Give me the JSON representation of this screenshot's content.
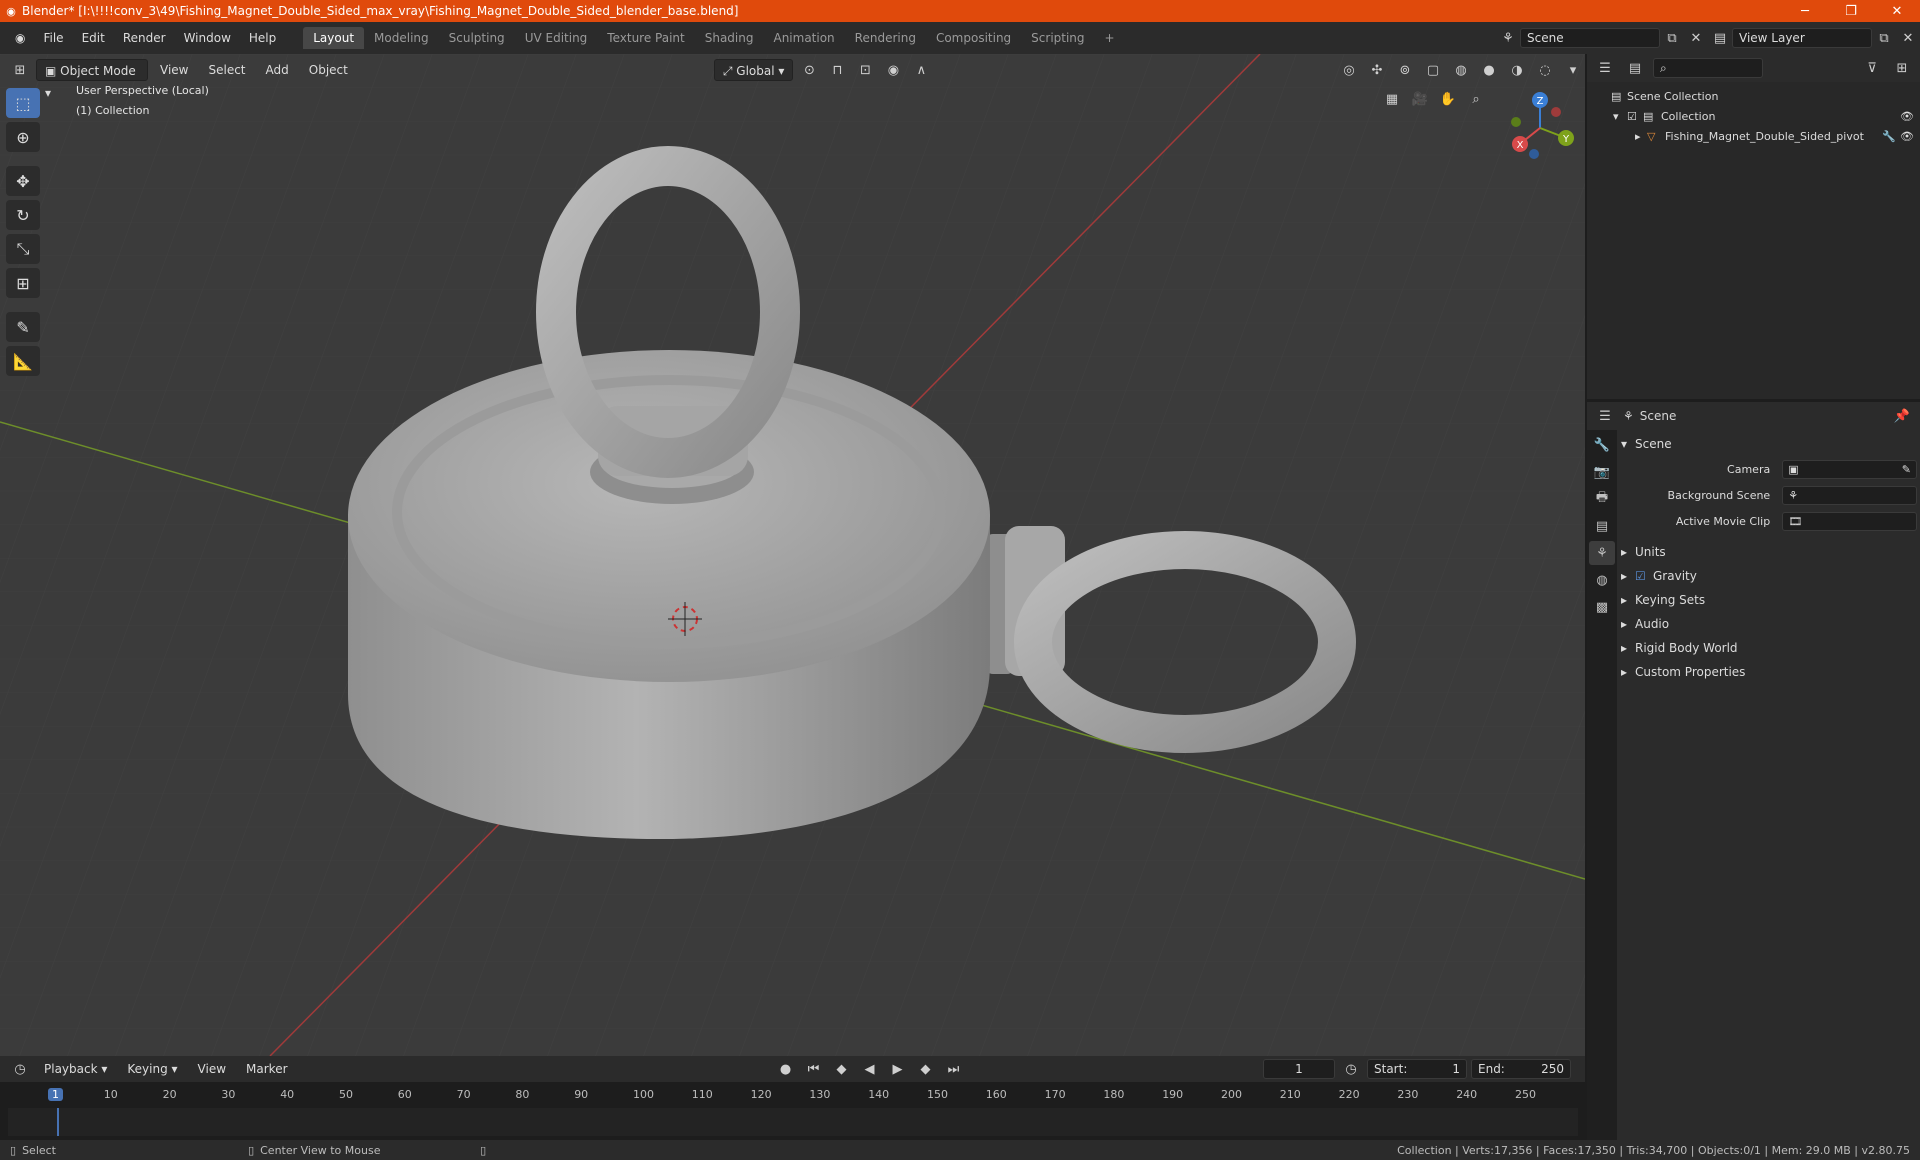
{
  "window": {
    "title": "Blender* [I:\\!!!!conv_3\\49\\Fishing_Magnet_Double_Sided_max_vray\\Fishing_Magnet_Double_Sided_blender_base.blend]"
  },
  "menu": [
    "File",
    "Edit",
    "Render",
    "Window",
    "Help"
  ],
  "workspaces": [
    "Layout",
    "Modeling",
    "Sculpting",
    "UV Editing",
    "Texture Paint",
    "Shading",
    "Animation",
    "Rendering",
    "Compositing",
    "Scripting"
  ],
  "active_workspace": "Layout",
  "scene_field": "Scene",
  "view_layer_field": "View Layer",
  "viewport": {
    "mode": "Object Mode",
    "menus": [
      "View",
      "Select",
      "Add",
      "Object"
    ],
    "transform_orientation": "Global",
    "info_line1": "User Perspective (Local)",
    "info_line2": "(1) Collection",
    "gizmo": {
      "x": "X",
      "y": "Y",
      "z": "Z"
    }
  },
  "outliner": {
    "items": [
      {
        "label": "Scene Collection"
      },
      {
        "label": "Collection"
      },
      {
        "label": "Fishing_Magnet_Double_Sided_pivot"
      }
    ]
  },
  "properties": {
    "header": "Scene",
    "panel_title": "Scene",
    "fields": [
      {
        "label": "Camera"
      },
      {
        "label": "Background Scene"
      },
      {
        "label": "Active Movie Clip"
      }
    ],
    "sections": [
      "Units",
      "Gravity",
      "Keying Sets",
      "Audio",
      "Rigid Body World",
      "Custom Properties"
    ],
    "gravity_checked": true
  },
  "timeline": {
    "menus": [
      "Playback",
      "Keying",
      "View",
      "Marker"
    ],
    "current_frame": "1",
    "start_label": "Start:",
    "start": "1",
    "end_label": "End:",
    "end": "250",
    "ticks": [
      "1",
      "10",
      "20",
      "30",
      "40",
      "50",
      "60",
      "70",
      "80",
      "90",
      "100",
      "110",
      "120",
      "130",
      "140",
      "150",
      "160",
      "170",
      "180",
      "190",
      "200",
      "210",
      "220",
      "230",
      "240",
      "250"
    ]
  },
  "status": {
    "left_action": "Select",
    "mid_action": "Center View to Mouse",
    "stats": "Collection | Verts:17,356 | Faces:17,350 | Tris:34,700 | Objects:0/1 | Mem: 29.0 MB | v2.80.75"
  }
}
